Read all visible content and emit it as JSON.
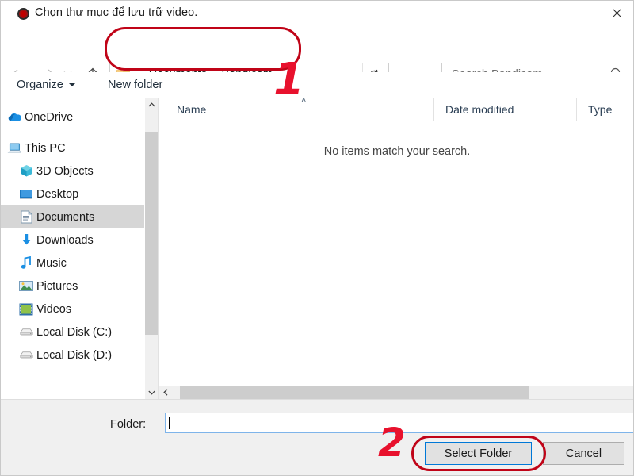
{
  "window": {
    "title": "Chọn thư mục để lưu trữ video.",
    "title_icon": "record-circle-icon",
    "close_label": "✕"
  },
  "nav": {
    "back_icon": "arrow-left-icon",
    "forward_icon": "arrow-right-icon",
    "recent_icon": "chevron-down-icon",
    "up_icon": "arrow-up-icon"
  },
  "address": {
    "folder_icon": "folder-icon",
    "prefix": "«",
    "crumbs": [
      "Documents",
      "Bandicam"
    ],
    "separator": "›",
    "dropdown_icon": "chevron-down-icon",
    "refresh_icon": "refresh-icon"
  },
  "search": {
    "placeholder": "Search Bandicam",
    "value": "",
    "icon": "search-icon"
  },
  "commandbar": {
    "organize_label": "Organize",
    "new_folder_label": "New folder",
    "view_icon": "list-view-icon",
    "help_label": "?"
  },
  "sidebar": {
    "items": [
      {
        "label": "OneDrive",
        "icon": "onedrive-cloud-icon",
        "indent": false,
        "selected": false
      },
      {
        "label": "This PC",
        "icon": "this-pc-icon",
        "indent": false,
        "selected": false
      },
      {
        "label": "3D Objects",
        "icon": "3d-objects-icon",
        "indent": true,
        "selected": false
      },
      {
        "label": "Desktop",
        "icon": "desktop-icon",
        "indent": true,
        "selected": false
      },
      {
        "label": "Documents",
        "icon": "documents-icon",
        "indent": true,
        "selected": true
      },
      {
        "label": "Downloads",
        "icon": "downloads-icon",
        "indent": true,
        "selected": false
      },
      {
        "label": "Music",
        "icon": "music-note-icon",
        "indent": true,
        "selected": false
      },
      {
        "label": "Pictures",
        "icon": "pictures-icon",
        "indent": true,
        "selected": false
      },
      {
        "label": "Videos",
        "icon": "videos-film-icon",
        "indent": true,
        "selected": false
      },
      {
        "label": "Local Disk (C:)",
        "icon": "hard-disk-icon",
        "indent": true,
        "selected": false
      },
      {
        "label": "Local Disk (D:)",
        "icon": "hard-disk-icon",
        "indent": true,
        "selected": false
      }
    ],
    "scroll_up_icon": "chevron-up-icon",
    "scroll_down_icon": "chevron-down-icon"
  },
  "filelist": {
    "columns": [
      "Name",
      "Date modified",
      "Type"
    ],
    "sort_caret": "˄",
    "rows": [],
    "empty_message": "No items match your search.",
    "hscroll_left_icon": "chevron-left-icon"
  },
  "footer": {
    "folder_label": "Folder:",
    "folder_value": "",
    "select_button": "Select Folder",
    "cancel_button": "Cancel"
  },
  "annotations": [
    {
      "id": "1",
      "number": "1",
      "target": "address-bar"
    },
    {
      "id": "2",
      "number": "2",
      "target": "select-folder-button"
    }
  ],
  "colors": {
    "annotation_red": "#c00418",
    "annotation_number_red": "#e8112d",
    "focus_blue": "#0078d7",
    "help_blue": "#0f6cbd",
    "selection_gray": "#d6d6d6"
  }
}
